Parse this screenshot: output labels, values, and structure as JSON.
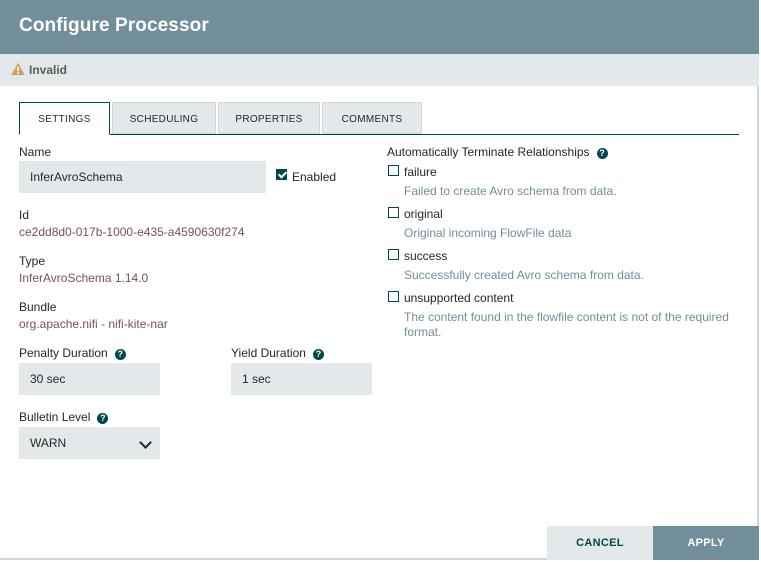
{
  "dialog": {
    "title": "Configure Processor",
    "status": "Invalid"
  },
  "tabs": [
    {
      "label": "SETTINGS",
      "active": true
    },
    {
      "label": "SCHEDULING",
      "active": false
    },
    {
      "label": "PROPERTIES",
      "active": false
    },
    {
      "label": "COMMENTS",
      "active": false
    }
  ],
  "settings": {
    "name_label": "Name",
    "name_value": "InferAvroSchema",
    "enabled_label": "Enabled",
    "enabled_checked": true,
    "id_label": "Id",
    "id_value": "ce2dd8d0-017b-1000-e435-a4590630f274",
    "type_label": "Type",
    "type_value": "InferAvroSchema 1.14.0",
    "bundle_label": "Bundle",
    "bundle_value": "org.apache.nifi - nifi-kite-nar",
    "penalty_label": "Penalty Duration",
    "penalty_value": "30 sec",
    "yield_label": "Yield Duration",
    "yield_value": "1 sec",
    "bulletin_label": "Bulletin Level",
    "bulletin_value": "WARN"
  },
  "relationships": {
    "heading": "Automatically Terminate Relationships",
    "items": [
      {
        "name": "failure",
        "description": "Failed to create Avro schema from data.",
        "checked": false
      },
      {
        "name": "original",
        "description": "Original incoming FlowFile data",
        "checked": false
      },
      {
        "name": "success",
        "description": "Successfully created Avro schema from data.",
        "checked": false
      },
      {
        "name": "unsupported content",
        "description": "The content found in the flowfile content is not of the required format.",
        "checked": false
      }
    ]
  },
  "footer": {
    "cancel_label": "CANCEL",
    "apply_label": "APPLY"
  },
  "colors": {
    "header": "#728e9b",
    "accent": "#004849",
    "field_bg": "#e3e8eb",
    "warning": "#cf9f5d",
    "value_text": "#775351"
  },
  "icons": {
    "status": "warning-triangle-icon",
    "help": "question-circle-icon",
    "select": "chevron-down-icon",
    "checkbox": "checkbox-icon"
  }
}
